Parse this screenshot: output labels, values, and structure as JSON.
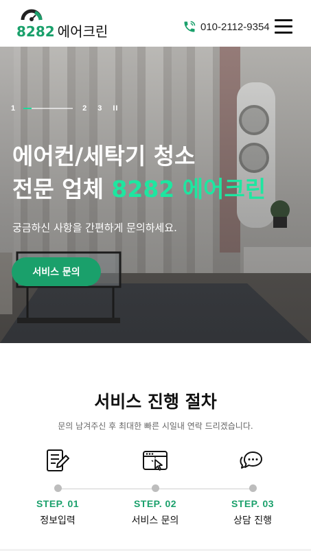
{
  "colors": {
    "brand": "#1aa06b",
    "accent": "#1ee6a0",
    "dot": "#bdbdbd"
  },
  "header": {
    "logo_number": "8282",
    "logo_name": "에어크린",
    "phone": "010-2112-9354",
    "phone_icon": "phone-icon",
    "menu_icon": "hamburger-icon"
  },
  "hero": {
    "pager": {
      "current": "1",
      "next": [
        "2",
        "3"
      ],
      "pause_label": "II"
    },
    "title_line1": "에어컨/세탁기 청소",
    "title_line2_prefix": "전문 업체 ",
    "title_line2_accent": "8282 에어크린",
    "subtitle": "궁금하신 사항을 간편하게 문의하세요.",
    "cta_label": "서비스 문의"
  },
  "process": {
    "title": "서비스 진행 절차",
    "subtitle": "문의 남겨주신 후 최대한 빠른 시일내 연락 드리겠습니다.",
    "steps": [
      {
        "label": "STEP. 01",
        "name": "정보입력",
        "icon": "form-edit-icon"
      },
      {
        "label": "STEP. 02",
        "name": "서비스 문의",
        "icon": "browser-click-icon"
      },
      {
        "label": "STEP. 03",
        "name": "상담 진행",
        "icon": "chat-bubbles-icon"
      }
    ]
  }
}
